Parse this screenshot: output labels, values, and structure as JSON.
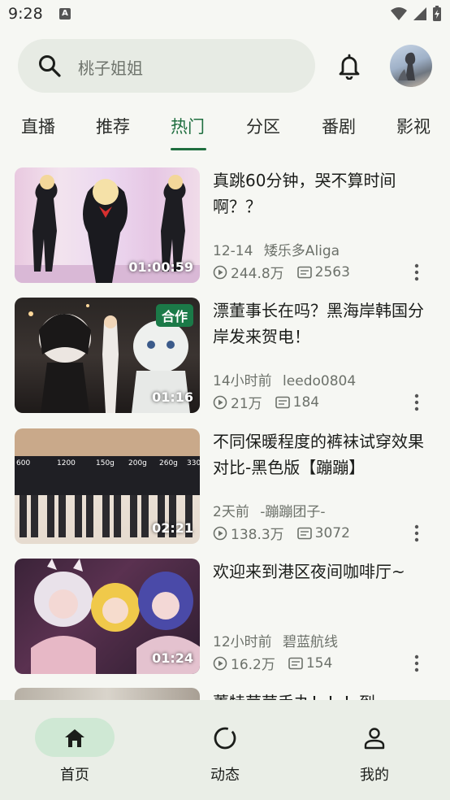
{
  "status": {
    "time": "9:28",
    "notif_badge": "A"
  },
  "search": {
    "placeholder": "桃子姐姐"
  },
  "tabs": [
    "直播",
    "推荐",
    "热门",
    "分区",
    "番剧",
    "影视"
  ],
  "active_tab": "热门",
  "videos": [
    {
      "title": "真跳60分钟，哭不算时间啊？？",
      "duration": "01:00:59",
      "date": "12-14",
      "author": "矮乐多Aliga",
      "views": "244.8万",
      "danmaku": "2563",
      "badge": ""
    },
    {
      "title": "漂董事长在吗？黑海岸韩国分岸发来贺电！",
      "duration": "01:16",
      "date": "14小时前",
      "author": "leedo0804",
      "views": "21万",
      "danmaku": "184",
      "badge": "合作"
    },
    {
      "title": "不同保暖程度的裤袜试穿效果对比-黑色版【蹦蹦】",
      "duration": "02:21",
      "date": "2天前",
      "author": "-蹦蹦团子-",
      "views": "138.3万",
      "danmaku": "3072",
      "badge": ""
    },
    {
      "title": "欢迎来到港区夜间咖啡厅~",
      "duration": "01:24",
      "date": "12小时前",
      "author": "碧蓝航线",
      "views": "16.2万",
      "danmaku": "154",
      "badge": ""
    }
  ],
  "partial_video": {
    "title": "菁特苹苹手办！！！到"
  },
  "thumb3_labels": [
    "600",
    "1200",
    "150g",
    "200g",
    "260g",
    "330"
  ],
  "bottom_nav": [
    {
      "label": "首页",
      "icon": "home-icon",
      "active": true
    },
    {
      "label": "动态",
      "icon": "dynamic-icon",
      "active": false
    },
    {
      "label": "我的",
      "icon": "profile-icon",
      "active": false
    }
  ],
  "colors": {
    "accent": "#1f6e3f",
    "badge": "#1b7a48",
    "background": "#f6f7f3",
    "nav_pill": "#cfe8d4"
  }
}
